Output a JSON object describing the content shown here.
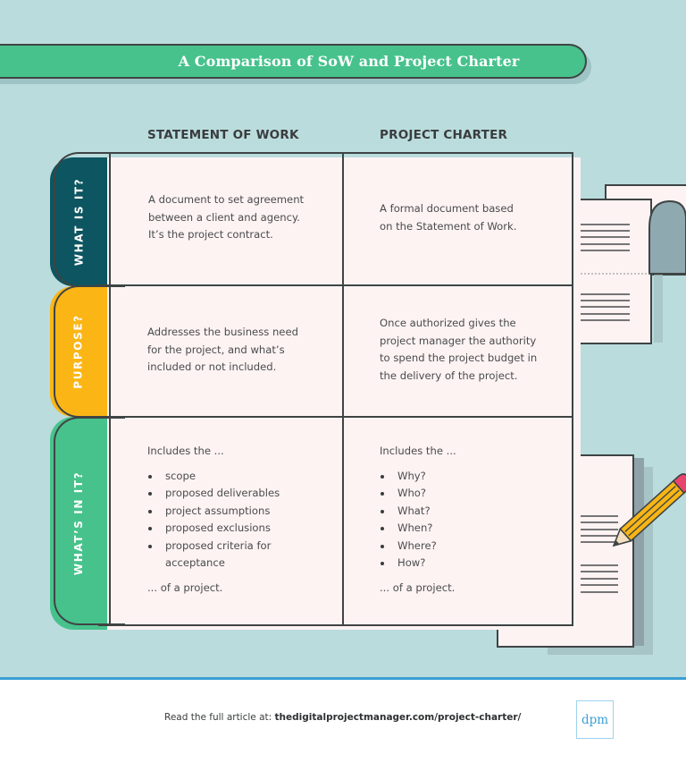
{
  "title": "A Comparison of SoW and Project Charter",
  "columns": {
    "sow": "STATEMENT OF WORK",
    "charter": "PROJECT CHARTER"
  },
  "rows": [
    {
      "label": "WHAT IS IT?",
      "color": "#0d5560",
      "sow": {
        "lines": [
          "A document to set agreement",
          "between a client and agency.",
          "It’s the project contract."
        ]
      },
      "charter": {
        "lines": [
          "A formal document based",
          "on the Statement of Work."
        ]
      }
    },
    {
      "label": "PURPOSE?",
      "color": "#fbb616",
      "sow": {
        "lines": [
          "Addresses the business need",
          "for the project, and what’s",
          "included or not included."
        ]
      },
      "charter": {
        "lines": [
          "Once authorized gives the",
          "project manager the authority",
          "to spend the project budget in",
          "the delivery of the project."
        ]
      }
    },
    {
      "label": "WHAT’S IN IT?",
      "color": "#47c28c",
      "sow": {
        "intro": "Includes the ...",
        "bullets": [
          "scope",
          "proposed deliverables",
          "project assumptions",
          "proposed exclusions",
          "proposed criteria for acceptance"
        ],
        "outro": "... of a project."
      },
      "charter": {
        "intro": "Includes the ...",
        "bullets": [
          "Why?",
          "Who?",
          "What?",
          "When?",
          "Where?",
          "How?"
        ],
        "outro": "... of a project."
      }
    }
  ],
  "footer": {
    "prefix": "Read the full article at: ",
    "link": "thedigitalprojectmanager.com/project-charter/",
    "logo": "dpm"
  },
  "colors": {
    "background": "#badcdd",
    "banner": "#47c28c",
    "accent_blue": "#3a9fd3",
    "pencil_body": "#f7b516",
    "eraser": "#e8456d"
  },
  "icons": [
    "document-stack-icon",
    "folded-document-icon",
    "pencil-icon"
  ]
}
